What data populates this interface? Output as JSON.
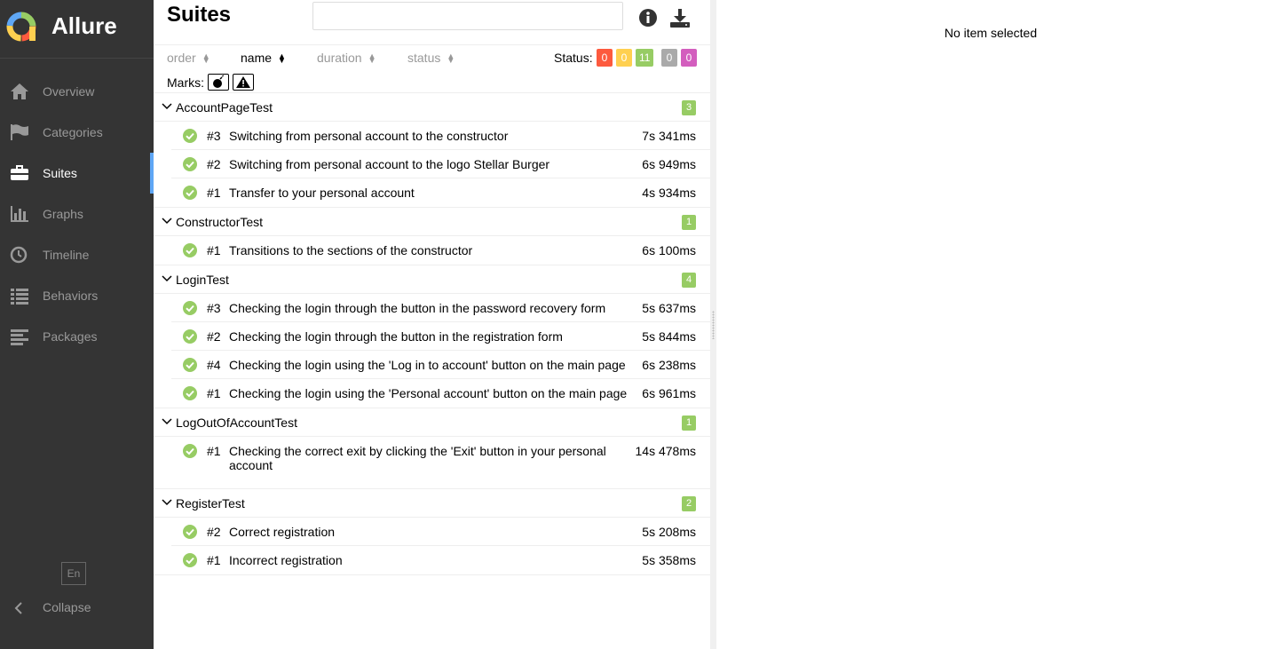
{
  "brand": {
    "name": "Allure"
  },
  "sidebar": {
    "items": [
      {
        "label": "Overview",
        "icon": "home-icon"
      },
      {
        "label": "Categories",
        "icon": "flag-icon"
      },
      {
        "label": "Suites",
        "icon": "briefcase-icon",
        "active": true
      },
      {
        "label": "Graphs",
        "icon": "bar-chart-icon"
      },
      {
        "label": "Timeline",
        "icon": "clock-icon"
      },
      {
        "label": "Behaviors",
        "icon": "list-icon"
      },
      {
        "label": "Packages",
        "icon": "align-left-icon"
      }
    ],
    "language": "En",
    "collapse_label": "Collapse",
    "active_color": "#5fa7f5"
  },
  "main": {
    "title": "Suites",
    "search": {
      "value": "",
      "placeholder": ""
    },
    "sort": {
      "order": "order",
      "name": "name",
      "duration": "duration",
      "status": "status",
      "active": "name"
    },
    "status_label": "Status:",
    "status_counts": [
      {
        "value": "0",
        "color": "#fd5a3e"
      },
      {
        "value": "0",
        "color": "#ffd050"
      },
      {
        "value": "11",
        "color": "#97cc64"
      },
      {
        "value": "0",
        "color": "#aaaaaa"
      },
      {
        "value": "0",
        "color": "#d35ebe"
      }
    ],
    "marks_label": "Marks:",
    "groups": [
      {
        "name": "AccountPageTest",
        "count": "3",
        "tests": [
          {
            "num": "#3",
            "name": "Switching from personal account to the constructor",
            "duration": "7s 341ms"
          },
          {
            "num": "#2",
            "name": "Switching from personal account to the logo Stellar Burger",
            "duration": "6s 949ms"
          },
          {
            "num": "#1",
            "name": "Transfer to your personal account",
            "duration": "4s 934ms"
          }
        ]
      },
      {
        "name": "ConstructorTest",
        "count": "1",
        "tests": [
          {
            "num": "#1",
            "name": "Transitions to the sections of the constructor",
            "duration": "6s 100ms"
          }
        ]
      },
      {
        "name": "LoginTest",
        "count": "4",
        "tests": [
          {
            "num": "#3",
            "name": "Checking the login through the button in the password recovery form",
            "duration": "5s 637ms"
          },
          {
            "num": "#2",
            "name": "Checking the login through the button in the registration form",
            "duration": "5s 844ms"
          },
          {
            "num": "#4",
            "name": "Checking the login using the 'Log in to account' button on the main page",
            "duration": "6s 238ms"
          },
          {
            "num": "#1",
            "name": "Checking the login using the 'Personal account' button on the main page",
            "duration": "6s 961ms"
          }
        ]
      },
      {
        "name": "LogOutOfAccountTest",
        "count": "1",
        "tests": [
          {
            "num": "#1",
            "name": "Checking the correct exit by clicking the 'Exit' button in your personal account",
            "duration": "14s 478ms",
            "tall": true
          }
        ]
      },
      {
        "name": "RegisterTest",
        "count": "2",
        "tests": [
          {
            "num": "#2",
            "name": "Correct registration",
            "duration": "5s 208ms"
          },
          {
            "num": "#1",
            "name": "Incorrect registration",
            "duration": "5s 358ms"
          }
        ]
      }
    ]
  },
  "detail": {
    "empty_text": "No item selected"
  }
}
